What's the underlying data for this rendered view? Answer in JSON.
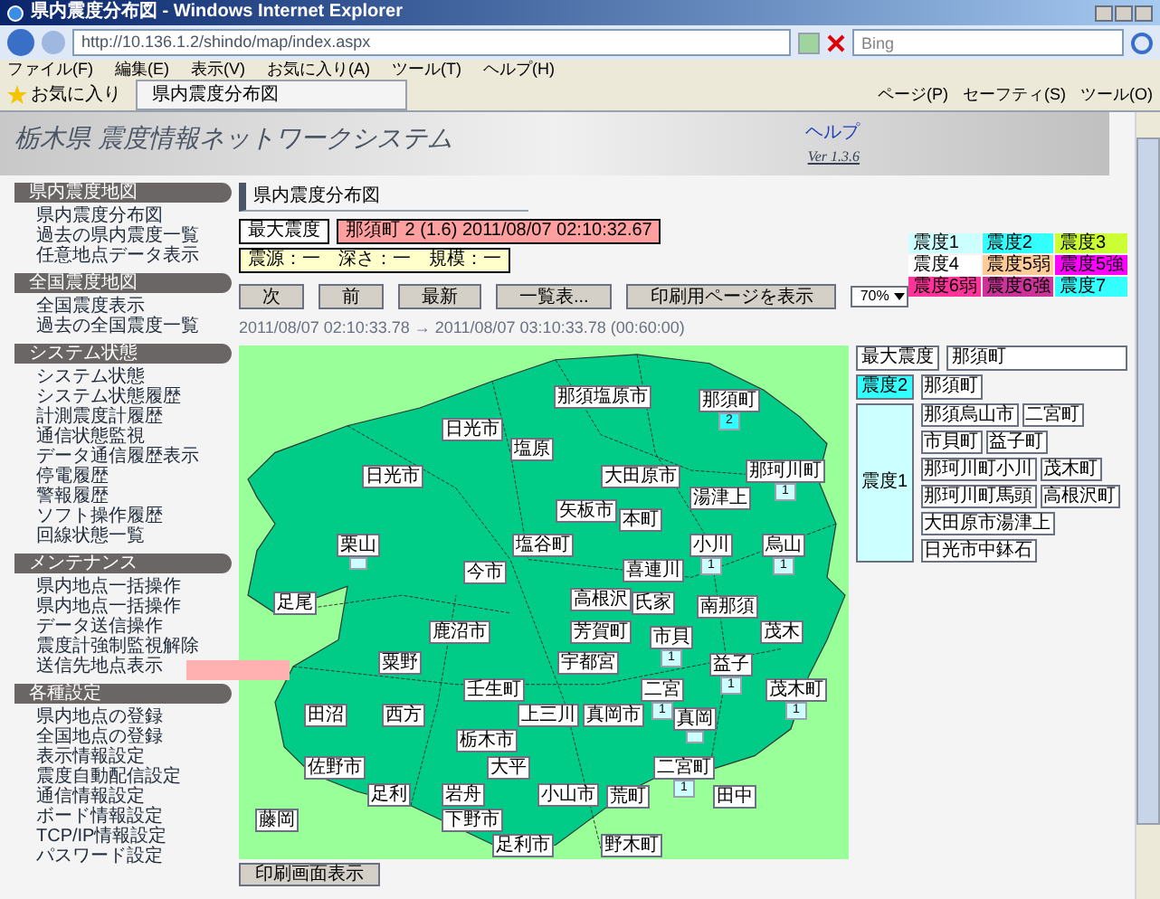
{
  "window": {
    "title": "県内震度分布図 - Windows Internet Explorer"
  },
  "address_bar": {
    "url": "http://10.136.1.2/shindo/map/index.aspx"
  },
  "search": {
    "placeholder": "Bing"
  },
  "menu": [
    "ファイル(F)",
    "編集(E)",
    "表示(V)",
    "お気に入り(A)",
    "ツール(T)",
    "ヘルプ(H)"
  ],
  "favorites": {
    "label": "お気に入り"
  },
  "tab": {
    "title": "県内震度分布図"
  },
  "toolbar": [
    "ページ(P)",
    "セーフティ(S)",
    "ツール(O)"
  ],
  "header": {
    "title": "栃木県 震度情報ネットワークシステム",
    "help": "ヘルプ",
    "version": "Ver 1.3.6"
  },
  "sidebar": [
    {
      "title": "県内震度地図",
      "items": [
        "県内震度分布図",
        "過去の県内震度一覧",
        "任意地点データ表示"
      ]
    },
    {
      "title": "全国震度地図",
      "items": [
        "全国震度表示",
        "過去の全国震度一覧"
      ]
    },
    {
      "title": "システム状態",
      "items": [
        "システム状態",
        "システム状態履歴",
        "計測震度計履歴",
        "通信状態監視",
        "データ通信履歴表示",
        "停電履歴",
        "警報履歴",
        "ソフト操作履歴",
        "回線状態一覧"
      ]
    },
    {
      "title": "メンテナンス",
      "items": [
        "県内地点一括操作",
        "県内地点一括操作",
        "データ送信操作",
        "震度計強制監視解除",
        "送信先地点表示"
      ]
    },
    {
      "title": "各種設定",
      "items": [
        "県内地点の登録",
        "全国地点の登録",
        "表示情報設定",
        "震度自動配信設定",
        "通信情報設定",
        "ボード情報設定",
        "TCP/IP情報設定",
        "パスワード設定"
      ]
    }
  ],
  "page_title": "県内震度分布図",
  "max_info": {
    "label": "最大震度",
    "text": "那須町 2 (1.6) 2011/08/07 02:10:32.67"
  },
  "epicenter": "震源：一　深さ：一　規模：一",
  "buttons": [
    "次",
    "前",
    "最新",
    "一覧表...",
    "印刷用ページを表示"
  ],
  "zoom_select": {
    "value": "70%"
  },
  "time_range": "2011/08/07 02:10:33.78 → 2011/08/07 03:10:33.78 (00:60:00)",
  "legend": [
    {
      "label": "震度1",
      "color": "#ccffff"
    },
    {
      "label": "震度2",
      "color": "#33ffff"
    },
    {
      "label": "震度3",
      "color": "#ccff33"
    },
    {
      "label": "震度4",
      "color": "#ffffff"
    },
    {
      "label": "震度5弱",
      "color": "#ffcc99"
    },
    {
      "label": "震度5強",
      "color": "#ff00ff"
    },
    {
      "label": "震度6弱",
      "color": "#ff3399"
    },
    {
      "label": "震度6強",
      "color": "#cc3399"
    },
    {
      "label": "震度7",
      "color": "#33ffff"
    }
  ],
  "map": {
    "labels": [
      {
        "name": "那須塩原市"
      },
      {
        "name": "那須町",
        "intensity": "2"
      },
      {
        "name": "日光市"
      },
      {
        "name": "塩原"
      },
      {
        "name": "日光市"
      },
      {
        "name": "大田原市"
      },
      {
        "name": "那珂川町",
        "intensity": "1"
      },
      {
        "name": "矢板市"
      },
      {
        "name": "湯津上"
      },
      {
        "name": "本町"
      },
      {
        "name": "栗山",
        "marked": true
      },
      {
        "name": "塩谷町"
      },
      {
        "name": "小川",
        "intensity": "1"
      },
      {
        "name": "烏山",
        "intensity": "1"
      },
      {
        "name": "今市"
      },
      {
        "name": "喜連川"
      },
      {
        "name": "足尾"
      },
      {
        "name": "高根沢"
      },
      {
        "name": "氏家"
      },
      {
        "name": "南那須"
      },
      {
        "name": "鹿沼市"
      },
      {
        "name": "芳賀町"
      },
      {
        "name": "市貝",
        "intensity": "1"
      },
      {
        "name": "茂木"
      },
      {
        "name": "粟野"
      },
      {
        "name": "宇都宮"
      },
      {
        "name": "益子",
        "intensity": "1"
      },
      {
        "name": "壬生町"
      },
      {
        "name": "二宮",
        "intensity": "1"
      },
      {
        "name": "茂木町",
        "intensity": "1"
      },
      {
        "name": "田沼"
      },
      {
        "name": "西方"
      },
      {
        "name": "上三川"
      },
      {
        "name": "真岡市"
      },
      {
        "name": "真岡",
        "marked": true
      },
      {
        "name": "栃木市"
      },
      {
        "name": "佐野市"
      },
      {
        "name": "大平"
      },
      {
        "name": "二宮町",
        "intensity": "1"
      },
      {
        "name": "足利"
      },
      {
        "name": "岩舟"
      },
      {
        "name": "小山市"
      },
      {
        "name": "荒町"
      },
      {
        "name": "田中"
      },
      {
        "name": "藤岡"
      },
      {
        "name": "下野市"
      },
      {
        "name": "足利市"
      },
      {
        "name": "野木町"
      }
    ]
  },
  "detail": {
    "max": {
      "label": "最大震度",
      "value": "那須町"
    },
    "groups": [
      {
        "label": "震度2",
        "color": "#33ffff",
        "places": [
          "那須町"
        ]
      },
      {
        "label": "震度1",
        "color": "#ccffff",
        "places": [
          "那須烏山市",
          "二宮町",
          "市貝町",
          "益子町",
          "那珂川町小川",
          "茂木町",
          "那珂川町馬頭",
          "高根沢町",
          "大田原市湯津上",
          "日光市中鉢石"
        ]
      }
    ]
  },
  "footer_button": "印刷画面表示"
}
